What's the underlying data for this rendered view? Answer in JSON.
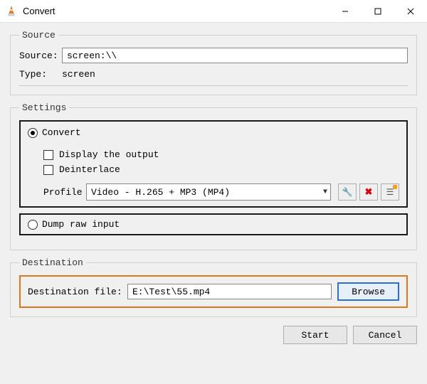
{
  "window": {
    "title": "Convert"
  },
  "source": {
    "legend": "Source",
    "source_label": "Source:",
    "source_value": "screen:\\\\",
    "type_label": "Type:",
    "type_value": "screen"
  },
  "settings": {
    "legend": "Settings",
    "convert_label": "Convert",
    "display_output_label": "Display the output",
    "deinterlace_label": "Deinterlace",
    "profile_label": "Profile",
    "profile_value": "Video - H.265 + MP3 (MP4)",
    "dump_raw_label": "Dump raw input"
  },
  "icons": {
    "wrench": "🔧",
    "delete": "✖",
    "new_profile": "☰"
  },
  "destination": {
    "legend": "Destination",
    "file_label": "Destination file:",
    "file_value": "E:\\Test\\55.mp4",
    "browse_label": "Browse"
  },
  "buttons": {
    "start": "Start",
    "cancel": "Cancel"
  }
}
